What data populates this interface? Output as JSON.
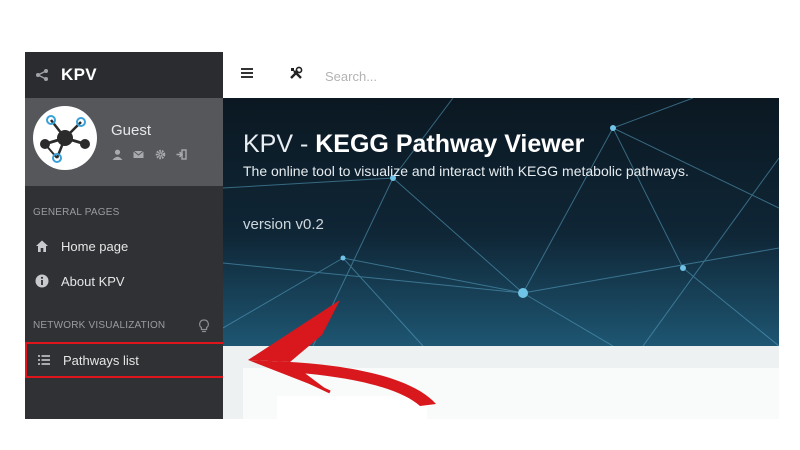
{
  "app": {
    "title": "KPV"
  },
  "user": {
    "name": "Guest"
  },
  "sidebar": {
    "sections": [
      {
        "label": "GENERAL PAGES"
      },
      {
        "label": "NETWORK VISUALIZATION"
      }
    ],
    "items": [
      {
        "label": "Home page",
        "icon": "home-icon"
      },
      {
        "label": "About KPV",
        "icon": "info-icon"
      },
      {
        "label": "Pathways list",
        "icon": "list-icon",
        "highlighted": true
      }
    ]
  },
  "topbar": {
    "search_placeholder": "Search..."
  },
  "hero": {
    "title_prefix": "KPV - ",
    "title_main": "KEGG Pathway Viewer",
    "subtitle": "The online tool to visualize and interact with KEGG metabolic pathways.",
    "version": "version v0.2"
  },
  "colors": {
    "sidebar": "#2f3135",
    "highlight": "#e0151b",
    "hero": "#0a1a26"
  }
}
